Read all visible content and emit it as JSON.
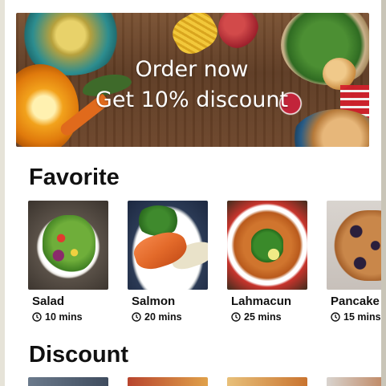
{
  "banner": {
    "line1": "Order now",
    "line2": "Get 10% discount"
  },
  "sections": {
    "favorite_title": "Favorite",
    "discount_title": "Discount"
  },
  "favorites": [
    {
      "name": "Salad",
      "time": "10 mins",
      "icon": "clock-icon"
    },
    {
      "name": "Salmon",
      "time": "20 mins",
      "icon": "clock-icon"
    },
    {
      "name": "Lahmacun",
      "time": "25 mins",
      "icon": "clock-icon"
    },
    {
      "name": "Pancake",
      "time": "15 mins",
      "icon": "clock-icon"
    }
  ],
  "colors": {
    "text": "#111111",
    "background": "#ffffff"
  }
}
